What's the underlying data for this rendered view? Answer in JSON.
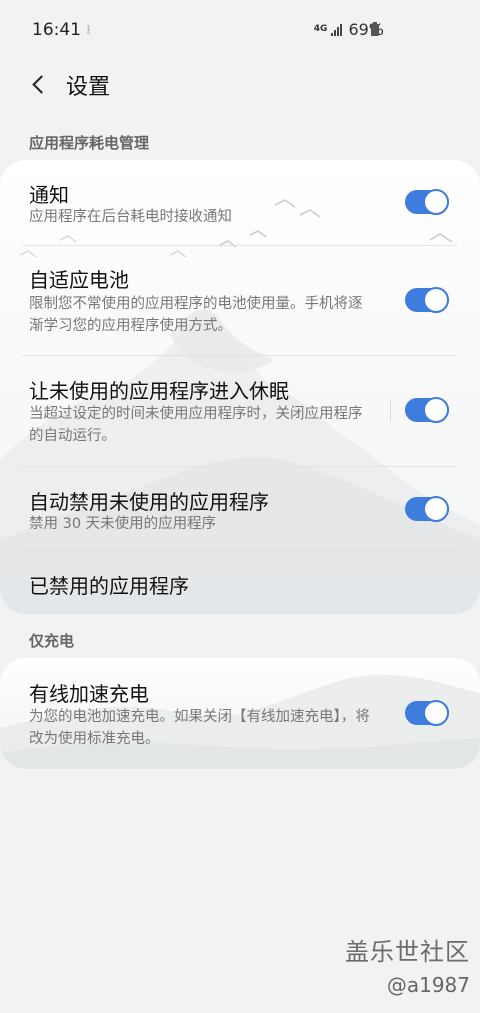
{
  "status_bar": {
    "time": "16:41",
    "download_glyph": "⭳",
    "network_label": "4G",
    "battery_text": "69%"
  },
  "header": {
    "title": "设置"
  },
  "sections": {
    "battery_management": {
      "title": "应用程序耗电管理",
      "rows": [
        {
          "title": "通知",
          "subtitle": "应用程序在后台耗电时接收通知",
          "toggle_on": true
        },
        {
          "title": "自适应电池",
          "subtitle": "限制您不常使用的应用程序的电池使用量。手机将逐渐学习您的应用程序使用方式。",
          "toggle_on": true
        },
        {
          "title": "让未使用的应用程序进入休眠",
          "subtitle": "当超过设定的时间未使用应用程序时，关闭应用程序的自动运行。",
          "toggle_on": true
        },
        {
          "title": "自动禁用未使用的应用程序",
          "subtitle": "禁用 30 天未使用的应用程序",
          "toggle_on": true
        },
        {
          "title": "已禁用的应用程序"
        }
      ]
    },
    "charging": {
      "title": "仅充电",
      "rows": [
        {
          "title": "有线加速充电",
          "subtitle": "为您的电池加速充电。如果关闭【有线加速充电】，将改为使用标准充电。",
          "toggle_on": true
        }
      ]
    }
  },
  "watermark": {
    "community": "盖乐世社区",
    "user": "@a1987"
  },
  "colors": {
    "accent": "#3e7cde",
    "background": "#f2f2f2",
    "card": "#ffffff"
  }
}
